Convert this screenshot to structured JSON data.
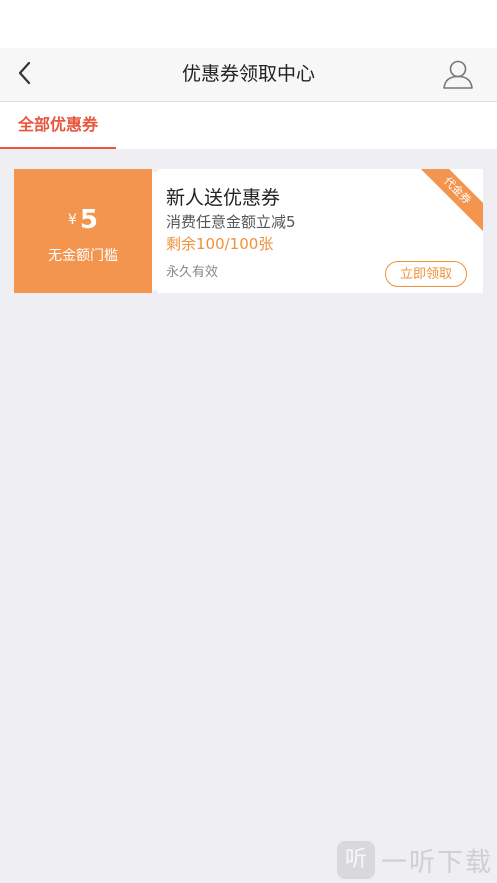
{
  "header": {
    "title": "优惠券领取中心"
  },
  "tabs": [
    {
      "label": "全部优惠券",
      "active": true
    }
  ],
  "coupons": [
    {
      "currency": "¥",
      "amount": "5",
      "threshold": "无金额门槛",
      "name": "新人送优惠券",
      "description": "消费任意金额立减5",
      "remaining": "剩余100/100张",
      "validity": "永久有效",
      "claim_label": "立即领取",
      "tag": "代金券"
    }
  ],
  "watermark": {
    "icon_text": "听",
    "text": "一听下载"
  },
  "colors": {
    "accent": "#e8563e",
    "coupon_orange": "#f3954f",
    "background": "#efeef3"
  }
}
